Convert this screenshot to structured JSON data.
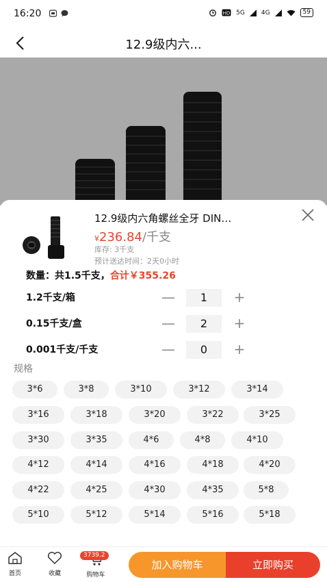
{
  "status_bar": {
    "time": "16:20",
    "network": "5G",
    "network2": "4G",
    "battery": "59"
  },
  "nav": {
    "title": "12.9级内六..."
  },
  "product": {
    "name": "12.9级内六角螺丝全牙 DIN…",
    "currency": "¥",
    "price": "236.84",
    "unit": "/千支",
    "stock": "库存: 3千支",
    "delivery": "预计送达时间：2天0小时"
  },
  "summary": {
    "prefix": "数量：共1.5千支，",
    "total": "合计￥355.26"
  },
  "quantities": [
    {
      "label": "1.2千支/箱",
      "value": "1"
    },
    {
      "label": "0.15千支/盒",
      "value": "2"
    },
    {
      "label": "0.001千支/千支",
      "value": "0"
    }
  ],
  "quantity_controls": {
    "minus": "—",
    "plus": "+"
  },
  "specs": {
    "title": "规格",
    "options": [
      "3*6",
      "3*8",
      "3*10",
      "3*12",
      "3*14",
      "3*16",
      "3*18",
      "3*20",
      "3*22",
      "3*25",
      "3*30",
      "3*35",
      "4*6",
      "4*8",
      "4*10",
      "4*12",
      "4*14",
      "4*16",
      "4*18",
      "4*20",
      "4*22",
      "4*25",
      "4*30",
      "4*35",
      "5*8",
      "5*10",
      "5*12",
      "5*14",
      "5*16",
      "5*18"
    ]
  },
  "bottom": {
    "home_label": "首页",
    "fav_label": "收藏",
    "cart_label": "购物车",
    "cart_badge": "3739.2",
    "add_cart": "加入购物车",
    "buy_now": "立即购买"
  },
  "colors": {
    "accent_red": "#e8442c",
    "accent_orange": "#f7962b"
  }
}
